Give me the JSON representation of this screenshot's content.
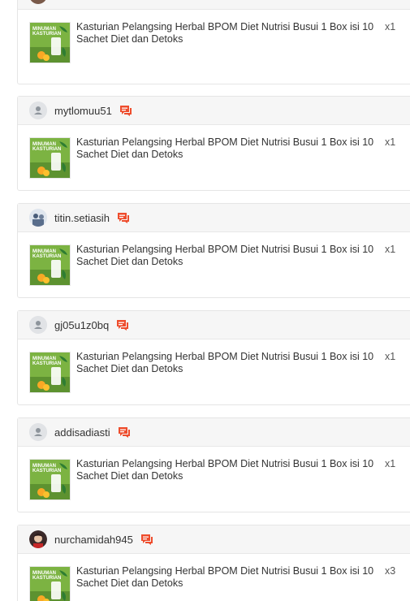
{
  "orders": [
    {
      "username": "",
      "avatar": "partial-avatar",
      "product": "Kasturian Pelangsing Herbal BPOM Diet Nutrisi Busui 1 Box isi 10 Sachet Diet dan Detoks",
      "qty": "x1"
    },
    {
      "username": "mytlomuu51",
      "avatar": "default-person-icon",
      "product": "Kasturian Pelangsing Herbal BPOM Diet Nutrisi Busui 1 Box isi 10 Sachet Diet dan Detoks",
      "qty": "x1"
    },
    {
      "username": "titin.setiasih",
      "avatar": "photo-avatar",
      "product": "Kasturian Pelangsing Herbal BPOM Diet Nutrisi Busui 1 Box isi 10 Sachet Diet dan Detoks",
      "qty": "x1"
    },
    {
      "username": "gj05u1z0bq",
      "avatar": "default-person-icon",
      "product": "Kasturian Pelangsing Herbal BPOM Diet Nutrisi Busui 1 Box isi 10 Sachet Diet dan Detoks",
      "qty": "x1"
    },
    {
      "username": "addisadiasti",
      "avatar": "default-person-icon",
      "product": "Kasturian Pelangsing Herbal BPOM Diet Nutrisi Busui 1 Box isi 10 Sachet Diet dan Detoks",
      "qty": "x1"
    },
    {
      "username": "nurchamidah945",
      "avatar": "photo-avatar",
      "product": "Kasturian Pelangsing Herbal BPOM Diet Nutrisi Busui 1 Box isi 10 Sachet Diet dan Detoks",
      "qty": "x3"
    }
  ],
  "thumbnail_text": {
    "line1": "MINUMAN",
    "line2": "KASTURIAN"
  },
  "colors": {
    "chat_accent": "#ee4d2d",
    "header_bg": "#f6f6f6",
    "thumb_green": "#6fa83a"
  }
}
